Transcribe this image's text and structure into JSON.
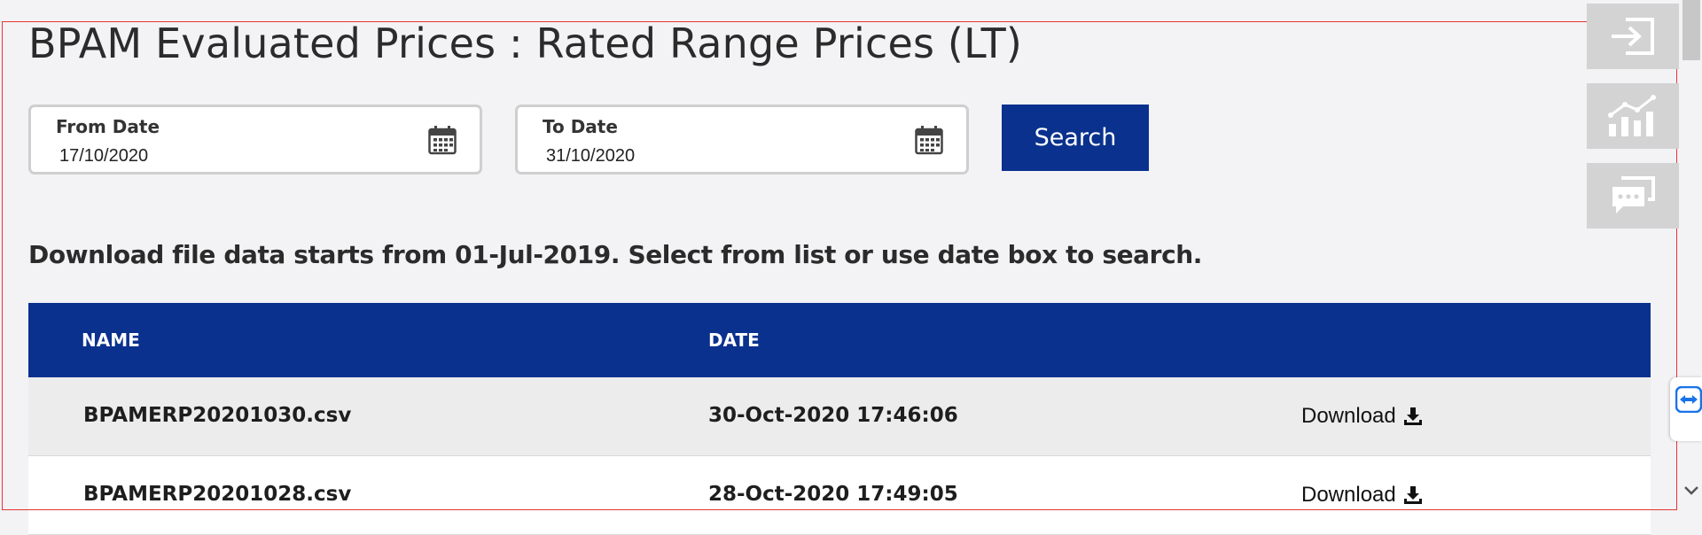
{
  "page": {
    "title": "BPAM Evaluated Prices : Rated Range Prices (LT)",
    "info_text": "Download file data starts from 01-Jul-2019. Select from list or use date box to search."
  },
  "filters": {
    "from_date": {
      "label": "From Date",
      "value": "17/10/2020"
    },
    "to_date": {
      "label": "To Date",
      "value": "31/10/2020"
    },
    "search_label": "Search"
  },
  "table": {
    "headers": {
      "name": "NAME",
      "date": "DATE"
    },
    "rows": [
      {
        "name": "BPAMERP20201030.csv",
        "date": "30-Oct-2020 17:46:06",
        "action": "Download"
      },
      {
        "name": "BPAMERP20201028.csv",
        "date": "28-Oct-2020 17:49:05",
        "action": "Download"
      }
    ]
  },
  "side_tools": [
    "login-icon",
    "chart-icon",
    "chat-icon"
  ],
  "colors": {
    "primary": "#0a318e",
    "background": "#f3f2f4",
    "highlight_border": "#e53535"
  }
}
